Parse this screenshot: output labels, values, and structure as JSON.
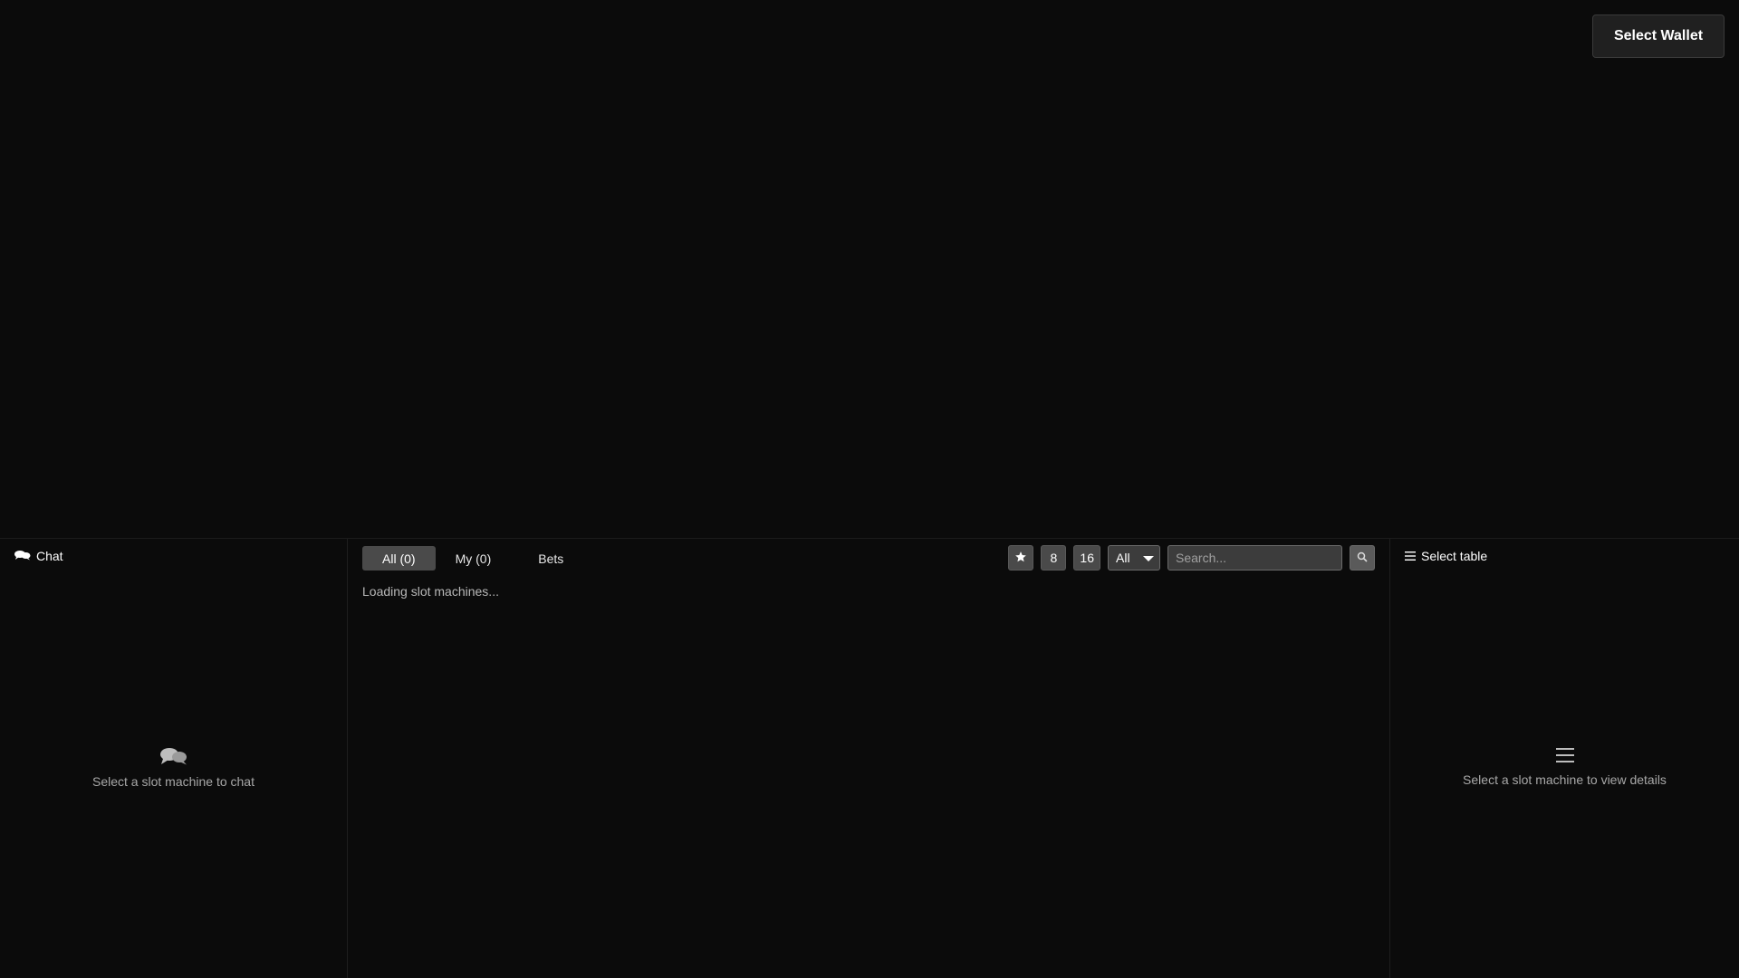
{
  "header": {
    "wallet_button": "Select Wallet"
  },
  "chat": {
    "title": "Chat",
    "icon": "chat-bubbles-icon",
    "empty_message": "Select a slot machine to chat"
  },
  "machines": {
    "tabs": [
      {
        "label": "All (0)",
        "active": true
      },
      {
        "label": "My (0)",
        "active": false
      },
      {
        "label": "Bets",
        "active": false
      }
    ],
    "controls": {
      "favorite_icon": "star-icon",
      "size_small": "8",
      "size_large": "16",
      "filter_selected": "All",
      "search_placeholder": "Search...",
      "search_icon": "magnifier-icon"
    },
    "status": "Loading slot machines..."
  },
  "details": {
    "title": "Select table",
    "icon": "list-icon",
    "empty_message": "Select a slot machine to view details"
  }
}
